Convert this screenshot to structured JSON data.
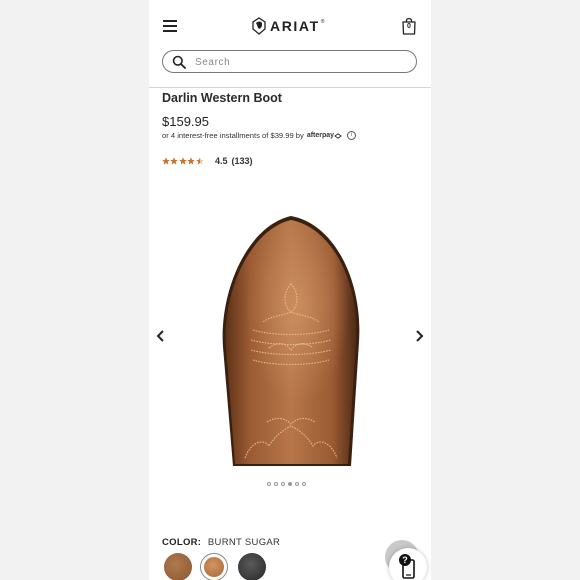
{
  "header": {
    "brand": "ARIAT",
    "trademark": "®",
    "cart_count": "0"
  },
  "search": {
    "placeholder": "Search"
  },
  "product": {
    "title": "Darlin Western Boot",
    "price": "$159.95",
    "installments_text": "or 4 interest-free installments of $39.99 by",
    "afterpay_label": "afterpay",
    "rating_value": "4.5",
    "rating_stars": 4.5,
    "rating_count": "(133)"
  },
  "gallery": {
    "image_count": 6,
    "active_index": 3
  },
  "color": {
    "label": "COLOR:",
    "value": "BURNT SUGAR",
    "swatches": [
      "#9a6440",
      "#c07f4c",
      "#3c3c3c"
    ]
  },
  "colors": {
    "star": "#c87533",
    "boot": "#a2623a",
    "stitching": "#e8b98a"
  }
}
